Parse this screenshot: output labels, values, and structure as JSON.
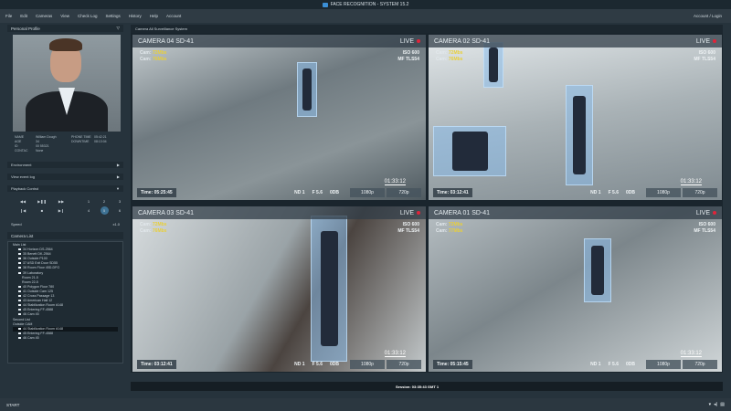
{
  "title": "FACE RECOGNITION - SYSTEM 15.2",
  "menu": [
    "File",
    "Edit",
    "Cameras",
    "View",
    "Check Log",
    "Settings",
    "History",
    "Help",
    "Account"
  ],
  "account": "Account / Login",
  "profile": {
    "header": "Personal Profile",
    "fields": [
      [
        "NAME",
        "William Dough",
        "PHONE TIME",
        "05:42:21"
      ],
      [
        "AGE",
        "34",
        "DOWNTIME",
        "08:13:04"
      ],
      [
        "ID",
        "00 55321",
        "",
        ""
      ],
      [
        "CONTAC",
        "None",
        "",
        ""
      ]
    ]
  },
  "panels": {
    "environment": "Environment",
    "event_log": "View event log",
    "playback": "Playback Control",
    "speed": "Speed",
    "speed_value": "x1.0",
    "camera_list": "Camera List"
  },
  "playback_keys": [
    "1",
    "2",
    "3",
    "REC",
    "4",
    "5",
    "6",
    "NEW"
  ],
  "camera_tree": [
    {
      "label": "Main List",
      "level": 0
    },
    {
      "label": "34 Horizon DS-2564",
      "level": 1
    },
    {
      "label": "35 Benett DK-2564",
      "level": 1
    },
    {
      "label": "36 Outside P100",
      "level": 1
    },
    {
      "label": "37 ASD Exit Door SD55",
      "level": 1
    },
    {
      "label": "38 Room Floor 45D-DFG",
      "level": 1
    },
    {
      "label": "39 Laboratory",
      "level": 1
    },
    {
      "label": "Room 21-5",
      "level": 2
    },
    {
      "label": "Room 22-5",
      "level": 2
    },
    {
      "label": "40 Polygon Floor 780",
      "level": 1
    },
    {
      "label": "41 Outside Cam 125",
      "level": 1
    },
    {
      "label": "42 Cross Passage 13",
      "level": 1
    },
    {
      "label": "43 American Hall 12",
      "level": 1
    },
    {
      "label": "44 Stabilization Room #148",
      "level": 1
    },
    {
      "label": "45 Entering FF-4588",
      "level": 1
    },
    {
      "label": "46 Cam 45",
      "level": 1
    },
    {
      "label": "Second List",
      "level": 0
    },
    {
      "label": "Outside CAM",
      "level": 0
    },
    {
      "label": "44 Stabilization Room #148",
      "level": 1,
      "selected": true
    },
    {
      "label": "45 Entering FF-4588",
      "level": 1
    },
    {
      "label": "46 Cam 45",
      "level": 1
    }
  ],
  "main_header": "Camera All Surveillance System",
  "cameras": [
    {
      "name": "CAMERA 04 SD-41",
      "live": "LIVE",
      "cam1": "72Mbs",
      "cam2": "76Mbs",
      "iso": "ISO 600",
      "mf": "MF TLS54",
      "time": "Time: 05:25:45",
      "nd": "ND 1",
      "f": "F 5.6",
      "db": "0DB",
      "res1": "1080p",
      "res2": "720p",
      "tc": "01:33:12"
    },
    {
      "name": "CAMERA 02 SD-41",
      "live": "LIVE",
      "cam1": "72Mbs",
      "cam2": "76Mbs",
      "iso": "ISO 600",
      "mf": "MF TLS54",
      "time": "Time: 03:12:41",
      "nd": "ND 1",
      "f": "F 5.6",
      "db": "0DB",
      "res1": "1080p",
      "res2": "720p",
      "tc": "01:33:12"
    },
    {
      "name": "CAMERA 03 SD-41",
      "live": "LIVE",
      "cam1": "72Mbs",
      "cam2": "76Mbs",
      "iso": "ISO 600",
      "mf": "MF TLS54",
      "time": "Time: 03:12:41",
      "nd": "ND 1",
      "f": "F 5.6",
      "db": "0DB",
      "res1": "1080p",
      "res2": "720p",
      "tc": "01:33:12"
    },
    {
      "name": "CAMERA 01 SD-41",
      "live": "LIVE",
      "cam1": "72Mbs",
      "cam2": "77Mbs",
      "iso": "ISO 600",
      "mf": "MF TLS54",
      "time": "Time: 05:15:45",
      "nd": "ND 1",
      "f": "F 5.6",
      "db": "0DB",
      "res1": "1080p",
      "res2": "720p",
      "tc": "01:33:12"
    }
  ],
  "cam_label": "Cam:",
  "session": "Session: 03:35:43 GMT 1",
  "footer": {
    "start": "START"
  }
}
